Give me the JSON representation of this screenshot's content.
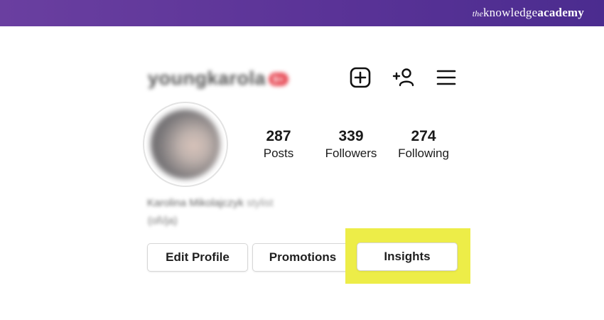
{
  "banner": {
    "brand_prefix": "the",
    "brand_middle": "knowledge",
    "brand_suffix": "academy",
    "background_color": "#5a3397"
  },
  "profile": {
    "username": "youngkarola",
    "notification_badge": "9+",
    "header_icons": [
      "plus-square-icon",
      "add-person-icon",
      "hamburger-menu-icon"
    ],
    "stats": [
      {
        "count": "287",
        "label": "Posts"
      },
      {
        "count": "339",
        "label": "Followers"
      },
      {
        "count": "274",
        "label": "Following"
      }
    ],
    "bio_name": "Karolina Mikolajczyk",
    "bio_role": "stylist",
    "bio_pronouns": "(ol\\/ja)"
  },
  "actions": {
    "edit_profile": "Edit Profile",
    "promotions": "Promotions",
    "insights": "Insights"
  },
  "highlight_color": "#eded48"
}
